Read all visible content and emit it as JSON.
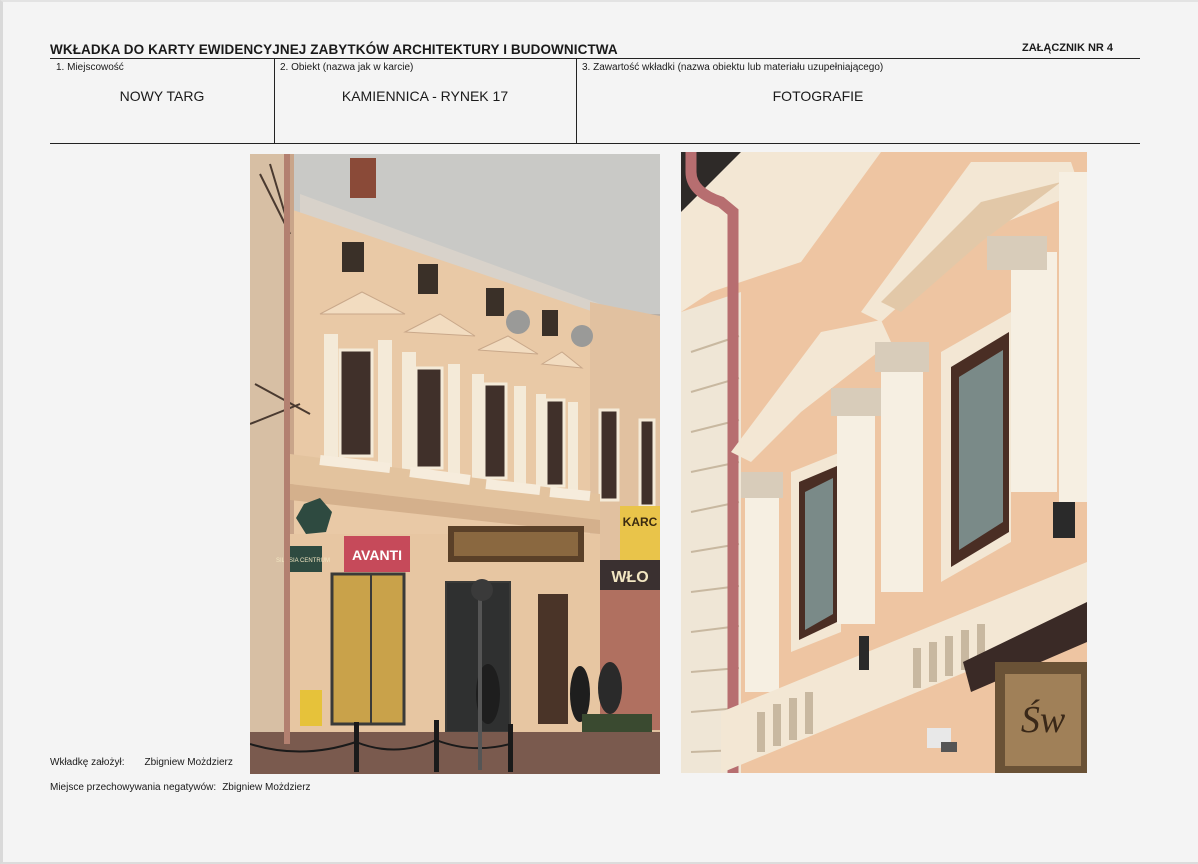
{
  "header": {
    "title": "WKŁADKA DO KARTY EWIDENCYJNEJ ZABYTKÓW ARCHITEKTURY I BUDOWNICTWA",
    "annex": "ZAŁĄCZNIK NR 4"
  },
  "fields": {
    "place_label": "1. Miejscowość",
    "place_value": "NOWY TARG",
    "object_label": "2. Obiekt (nazwa jak w karcie)",
    "object_value": "KAMIENNICA - RYNEK 17",
    "content_label": "3. Zawartość wkładki (nazwa obiektu lub materiału uzupełniającego)",
    "content_value": "FOTOGRAFIE"
  },
  "photos": {
    "left": {
      "signs": {
        "shop1": "AVANTI",
        "shop2": "WŁO",
        "shop3": "KARC",
        "logo": "SILESIA CENTRUM"
      }
    },
    "right": {
      "sign": "Św"
    }
  },
  "footer": {
    "founder_label": "Wkładkę założył:",
    "founder_value": "Zbigniew Możdzierz",
    "storage_label": "Miejsce przechowywania negatywów:",
    "storage_value": "Zbigniew Możdzierz"
  }
}
